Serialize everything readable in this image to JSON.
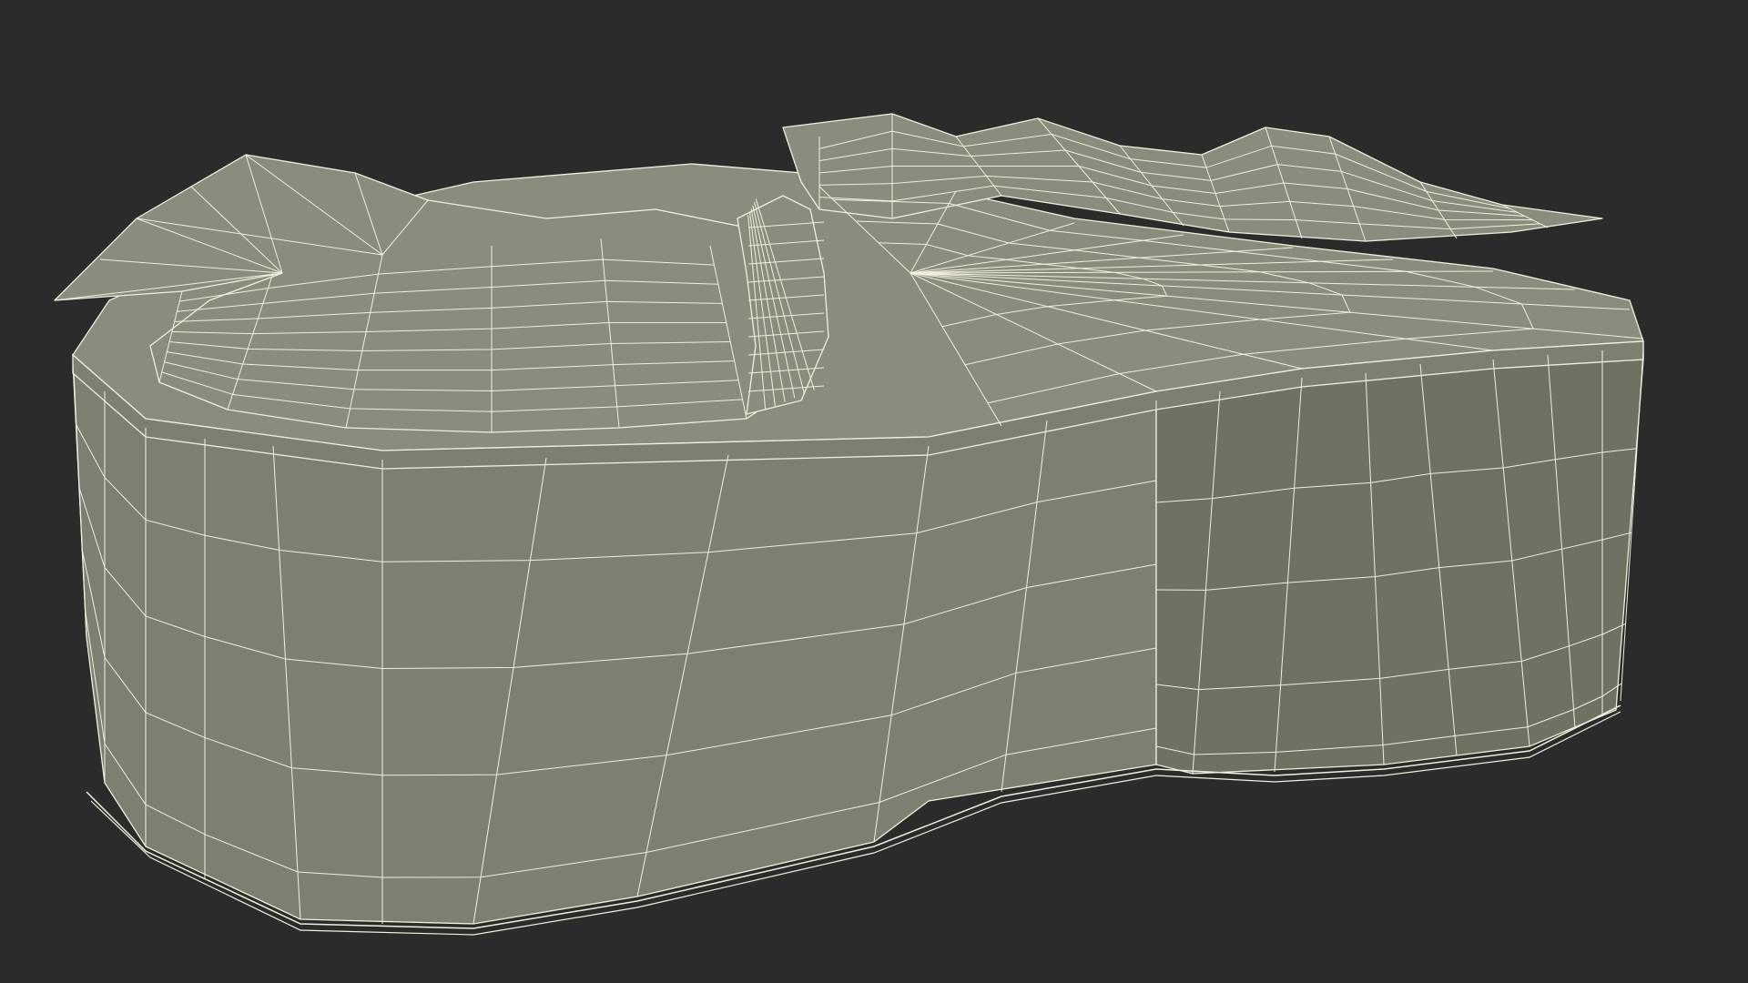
{
  "scene": {
    "subject": "heart-shaped-gift-box-wireframe",
    "colors": {
      "background": "#2b2b2b",
      "surface": "#7d7f70",
      "surface_dark": "#6f7163",
      "surface_light": "#8a8c7d",
      "wire": "#f2f0dc",
      "shadow": "#1f1f1f"
    }
  }
}
